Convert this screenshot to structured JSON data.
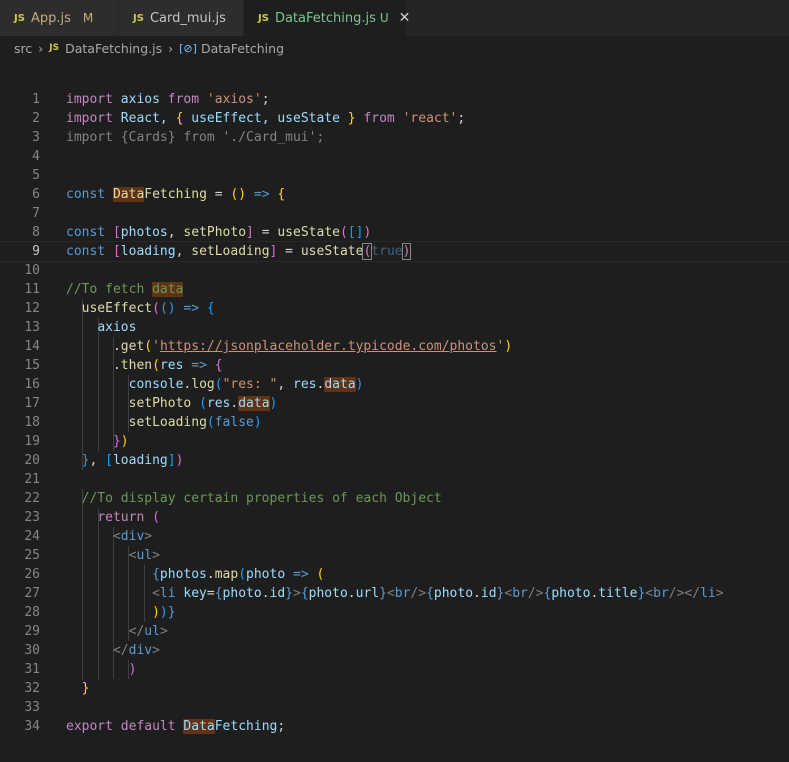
{
  "tabs": [
    {
      "label": "App.js",
      "status": "M"
    },
    {
      "label": "Card_mui.js",
      "status": ""
    },
    {
      "label": "DataFetching.js",
      "status": "U"
    }
  ],
  "breadcrumb": {
    "folder": "src",
    "file": "DataFetching.js",
    "symbol": "DataFetching"
  },
  "lines": [
    [
      [
        "import",
        "ctl"
      ],
      [
        " axios ",
        "var"
      ],
      [
        "from",
        "ctl"
      ],
      [
        " ",
        ""
      ],
      [
        "'axios'",
        "str"
      ],
      [
        ";",
        ""
      ]
    ],
    [
      [
        "import",
        "ctl"
      ],
      [
        " React, ",
        "var"
      ],
      [
        "{",
        "b1"
      ],
      [
        " useEffect, useState ",
        "var"
      ],
      [
        "}",
        "b1"
      ],
      [
        " ",
        ""
      ],
      [
        "from",
        "ctl"
      ],
      [
        " ",
        ""
      ],
      [
        "'react'",
        "str"
      ],
      [
        ";",
        ""
      ]
    ],
    [
      [
        "import {Cards} from './Card_mui';",
        "dim"
      ]
    ],
    [],
    [],
    [
      [
        "const",
        "kw"
      ],
      [
        " ",
        ""
      ],
      [
        "Data",
        "fn hl"
      ],
      [
        "Fetching",
        "fn"
      ],
      [
        " = ",
        ""
      ],
      [
        "()",
        "b1"
      ],
      [
        " ",
        ""
      ],
      [
        "=>",
        "kw"
      ],
      [
        " ",
        ""
      ],
      [
        "{",
        "b1"
      ]
    ],
    [],
    [
      [
        "const",
        "kw"
      ],
      [
        " ",
        ""
      ],
      [
        "[",
        "b2"
      ],
      [
        "photos",
        "var"
      ],
      [
        ", ",
        ""
      ],
      [
        "setPhoto",
        "fn"
      ],
      [
        "]",
        "b2"
      ],
      [
        " = ",
        ""
      ],
      [
        "useState",
        "fn"
      ],
      [
        "(",
        "b2"
      ],
      [
        "[]",
        "b3"
      ],
      [
        ")",
        "b2"
      ]
    ],
    [
      [
        "const",
        "kw"
      ],
      [
        " ",
        ""
      ],
      [
        "[",
        "b2"
      ],
      [
        "loading",
        "var"
      ],
      [
        ", ",
        ""
      ],
      [
        "setLoading",
        "fn"
      ],
      [
        "]",
        "b2"
      ],
      [
        " = ",
        ""
      ],
      [
        "useState",
        "fn"
      ],
      [
        "(",
        "b2 bm"
      ],
      [
        "true",
        "kw dim"
      ],
      [
        ")",
        "b2 bm"
      ]
    ],
    [],
    [
      [
        "//To fetch ",
        "cmt"
      ],
      [
        "data",
        "cmt hl"
      ]
    ],
    [
      [
        "  ",
        ""
      ],
      [
        "useEffect",
        "fn"
      ],
      [
        "(",
        "b2"
      ],
      [
        "()",
        "b3"
      ],
      [
        " ",
        ""
      ],
      [
        "=>",
        "kw"
      ],
      [
        " ",
        ""
      ],
      [
        "{",
        "b3"
      ]
    ],
    [
      [
        "    ",
        ""
      ],
      [
        "axios",
        "var"
      ]
    ],
    [
      [
        "      .",
        ""
      ],
      [
        "get",
        "fn"
      ],
      [
        "(",
        "b1"
      ],
      [
        "'",
        "str"
      ],
      [
        "https://jsonplaceholder.typicode.com/photos",
        "str url"
      ],
      [
        "'",
        "str"
      ],
      [
        ")",
        "b1"
      ]
    ],
    [
      [
        "      .",
        ""
      ],
      [
        "then",
        "fn"
      ],
      [
        "(",
        "b1"
      ],
      [
        "res",
        "var"
      ],
      [
        " ",
        ""
      ],
      [
        "=>",
        "kw"
      ],
      [
        " ",
        ""
      ],
      [
        "{",
        "b2"
      ]
    ],
    [
      [
        "        ",
        ""
      ],
      [
        "console",
        "var"
      ],
      [
        ".",
        ""
      ],
      [
        "log",
        "fn"
      ],
      [
        "(",
        "b3"
      ],
      [
        "\"res: \"",
        "str"
      ],
      [
        ", ",
        ""
      ],
      [
        "res",
        "var"
      ],
      [
        ".",
        ""
      ],
      [
        "data",
        "var hl"
      ],
      [
        ")",
        "b3"
      ]
    ],
    [
      [
        "        ",
        ""
      ],
      [
        "setPhoto",
        "fn"
      ],
      [
        " ",
        ""
      ],
      [
        "(",
        "b3"
      ],
      [
        "res",
        "var"
      ],
      [
        ".",
        ""
      ],
      [
        "data",
        "var hl"
      ],
      [
        ")",
        "b3"
      ]
    ],
    [
      [
        "        ",
        ""
      ],
      [
        "setLoading",
        "fn"
      ],
      [
        "(",
        "b3"
      ],
      [
        "false",
        "kw"
      ],
      [
        ")",
        "b3"
      ]
    ],
    [
      [
        "      ",
        ""
      ],
      [
        "}",
        "b2"
      ],
      [
        ")",
        "b1"
      ]
    ],
    [
      [
        "  ",
        ""
      ],
      [
        "}",
        "b3"
      ],
      [
        ", ",
        ""
      ],
      [
        "[",
        "b3"
      ],
      [
        "loading",
        "var"
      ],
      [
        "]",
        "b3"
      ],
      [
        ")",
        "b2"
      ]
    ],
    [],
    [
      [
        "  ",
        ""
      ],
      [
        "//To display certain properties of each Object",
        "cmt"
      ]
    ],
    [
      [
        "    ",
        ""
      ],
      [
        "return",
        "ctl"
      ],
      [
        " ",
        ""
      ],
      [
        "(",
        "b2"
      ]
    ],
    [
      [
        "      ",
        ""
      ],
      [
        "<",
        "tag"
      ],
      [
        "div",
        "tn"
      ],
      [
        ">",
        "tag"
      ]
    ],
    [
      [
        "        ",
        ""
      ],
      [
        "<",
        "tag"
      ],
      [
        "ul",
        "tn"
      ],
      [
        ">",
        "tag"
      ]
    ],
    [
      [
        "           ",
        ""
      ],
      [
        "{",
        "kw"
      ],
      [
        "photos",
        "var"
      ],
      [
        ".",
        ""
      ],
      [
        "map",
        "fn"
      ],
      [
        "(",
        "b3"
      ],
      [
        "photo",
        "var"
      ],
      [
        " ",
        ""
      ],
      [
        "=>",
        "kw"
      ],
      [
        " ",
        ""
      ],
      [
        "(",
        "b1"
      ]
    ],
    [
      [
        "           ",
        ""
      ],
      [
        "<",
        "tag"
      ],
      [
        "li",
        "tn"
      ],
      [
        " ",
        ""
      ],
      [
        "key",
        "var"
      ],
      [
        "=",
        ""
      ],
      [
        "{",
        "kw"
      ],
      [
        "photo",
        "var"
      ],
      [
        ".",
        ""
      ],
      [
        "id",
        "var"
      ],
      [
        "}",
        "kw"
      ],
      [
        ">",
        "tag"
      ],
      [
        "{",
        "kw"
      ],
      [
        "photo",
        "var"
      ],
      [
        ".",
        ""
      ],
      [
        "url",
        "var"
      ],
      [
        "}",
        "kw"
      ],
      [
        "<",
        "tag"
      ],
      [
        "br",
        "tn"
      ],
      [
        "/>",
        "tag"
      ],
      [
        "{",
        "kw"
      ],
      [
        "photo",
        "var"
      ],
      [
        ".",
        ""
      ],
      [
        "id",
        "var"
      ],
      [
        "}",
        "kw"
      ],
      [
        "<",
        "tag"
      ],
      [
        "br",
        "tn"
      ],
      [
        "/>",
        "tag"
      ],
      [
        "{",
        "kw"
      ],
      [
        "photo",
        "var"
      ],
      [
        ".",
        ""
      ],
      [
        "title",
        "var"
      ],
      [
        "}",
        "kw"
      ],
      [
        "<",
        "tag"
      ],
      [
        "br",
        "tn"
      ],
      [
        "/>",
        "tag"
      ],
      [
        "</",
        "tag"
      ],
      [
        "li",
        "tn"
      ],
      [
        ">",
        "tag"
      ]
    ],
    [
      [
        "           ",
        ""
      ],
      [
        ")",
        "b1"
      ],
      [
        ")",
        "b3"
      ],
      [
        "}",
        "kw"
      ]
    ],
    [
      [
        "        ",
        ""
      ],
      [
        "</",
        "tag"
      ],
      [
        "ul",
        "tn"
      ],
      [
        ">",
        "tag"
      ]
    ],
    [
      [
        "      ",
        ""
      ],
      [
        "</",
        "tag"
      ],
      [
        "div",
        "tn"
      ],
      [
        ">",
        "tag"
      ]
    ],
    [
      [
        "        ",
        ""
      ],
      [
        ")",
        "b2"
      ]
    ],
    [
      [
        "  ",
        ""
      ],
      [
        "}",
        "b1"
      ]
    ],
    [],
    [
      [
        "export",
        "ctl"
      ],
      [
        " ",
        ""
      ],
      [
        "default",
        "ctl"
      ],
      [
        " ",
        ""
      ],
      [
        "Data",
        "var hl"
      ],
      [
        "Fetching",
        "var"
      ],
      [
        ";",
        ""
      ]
    ]
  ],
  "guides": [
    [],
    [],
    [],
    [],
    [],
    [],
    [],
    [],
    [],
    [],
    [],
    [
      0
    ],
    [
      0,
      1
    ],
    [
      0,
      1,
      2
    ],
    [
      0,
      1,
      2
    ],
    [
      0,
      1,
      2,
      3
    ],
    [
      0,
      1,
      2,
      3
    ],
    [
      0,
      1,
      2,
      3
    ],
    [
      0,
      1,
      2
    ],
    [
      0
    ],
    [],
    [
      0
    ],
    [
      0,
      1
    ],
    [
      0,
      1,
      2
    ],
    [
      0,
      1,
      2,
      3
    ],
    [
      0,
      1,
      2,
      3,
      4
    ],
    [
      0,
      1,
      2,
      3,
      4
    ],
    [
      0,
      1,
      2,
      3,
      4
    ],
    [
      0,
      1,
      2,
      3
    ],
    [
      0,
      1,
      2
    ],
    [
      0,
      1,
      2,
      3
    ],
    [],
    [],
    []
  ]
}
